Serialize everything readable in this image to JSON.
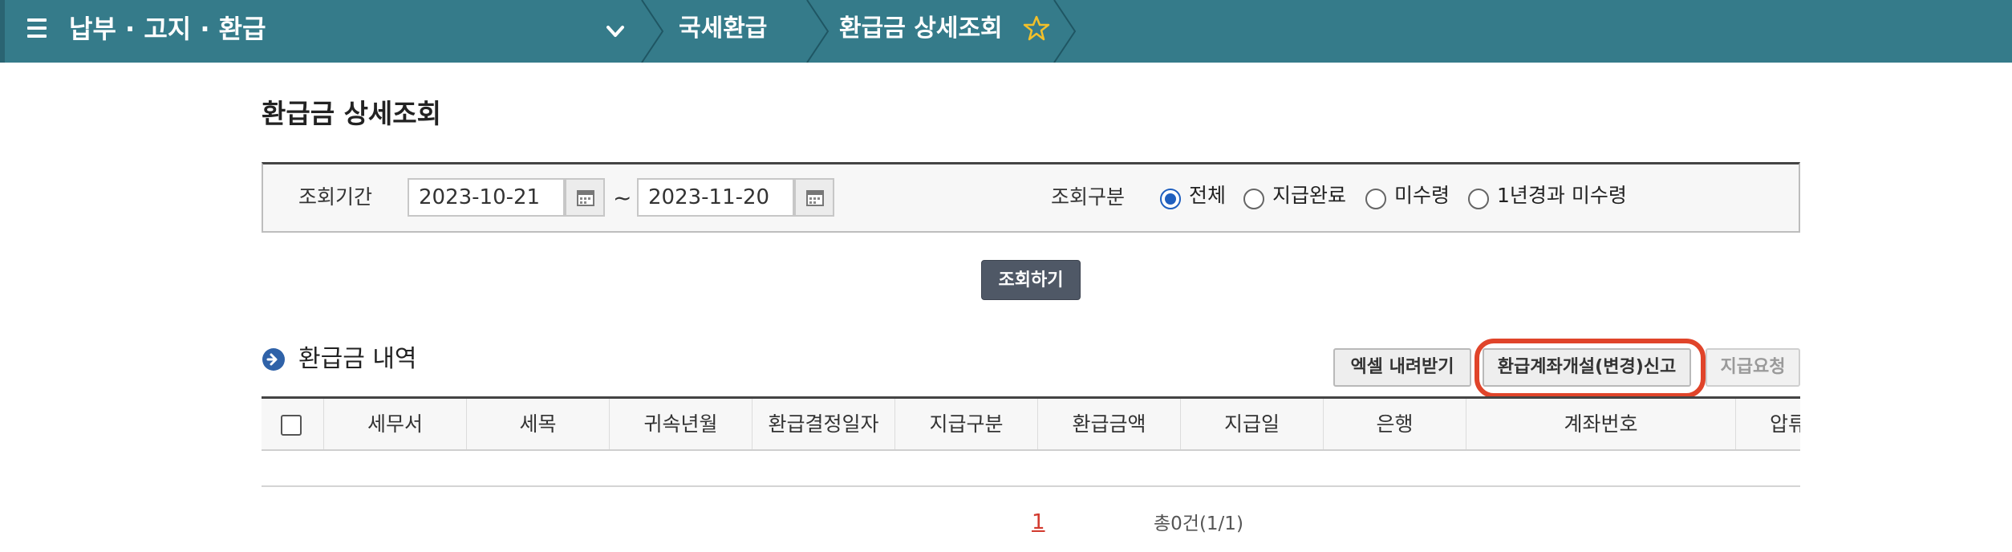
{
  "topbar": {
    "title": "납부 · 고지 · 환급",
    "breadcrumbs": [
      "국세환급",
      "환급금 상세조회"
    ]
  },
  "page": {
    "title": "환급금 상세조회"
  },
  "search": {
    "period_label": "조회기간",
    "start_date": "2023-10-21",
    "end_date": "2023-11-20",
    "tilde": "~",
    "type_label": "조회구분",
    "options": [
      {
        "label": "전체",
        "checked": true
      },
      {
        "label": "지급완료",
        "checked": false
      },
      {
        "label": "미수령",
        "checked": false
      },
      {
        "label": "1년경과 미수령",
        "checked": false
      }
    ],
    "submit_label": "조회하기"
  },
  "section": {
    "title": "환급금 내역",
    "excel_label": "엑셀 내려받기",
    "account_label": "환급계좌개설(변경)신고",
    "request_label": "지급요청"
  },
  "table": {
    "columns": [
      "세무서",
      "세목",
      "귀속년월",
      "환급결정일자",
      "지급구분",
      "환급금액",
      "지급일",
      "은행",
      "계좌번호",
      "압류"
    ]
  },
  "pagination": {
    "current": "1",
    "total": "총0건(1/1)"
  },
  "colors": {
    "topbar": "#357b8a",
    "search_button": "#4f5866",
    "radio_selected": "#1f5fbf",
    "highlight": "#e0442a",
    "page_current": "#d23a2e"
  }
}
